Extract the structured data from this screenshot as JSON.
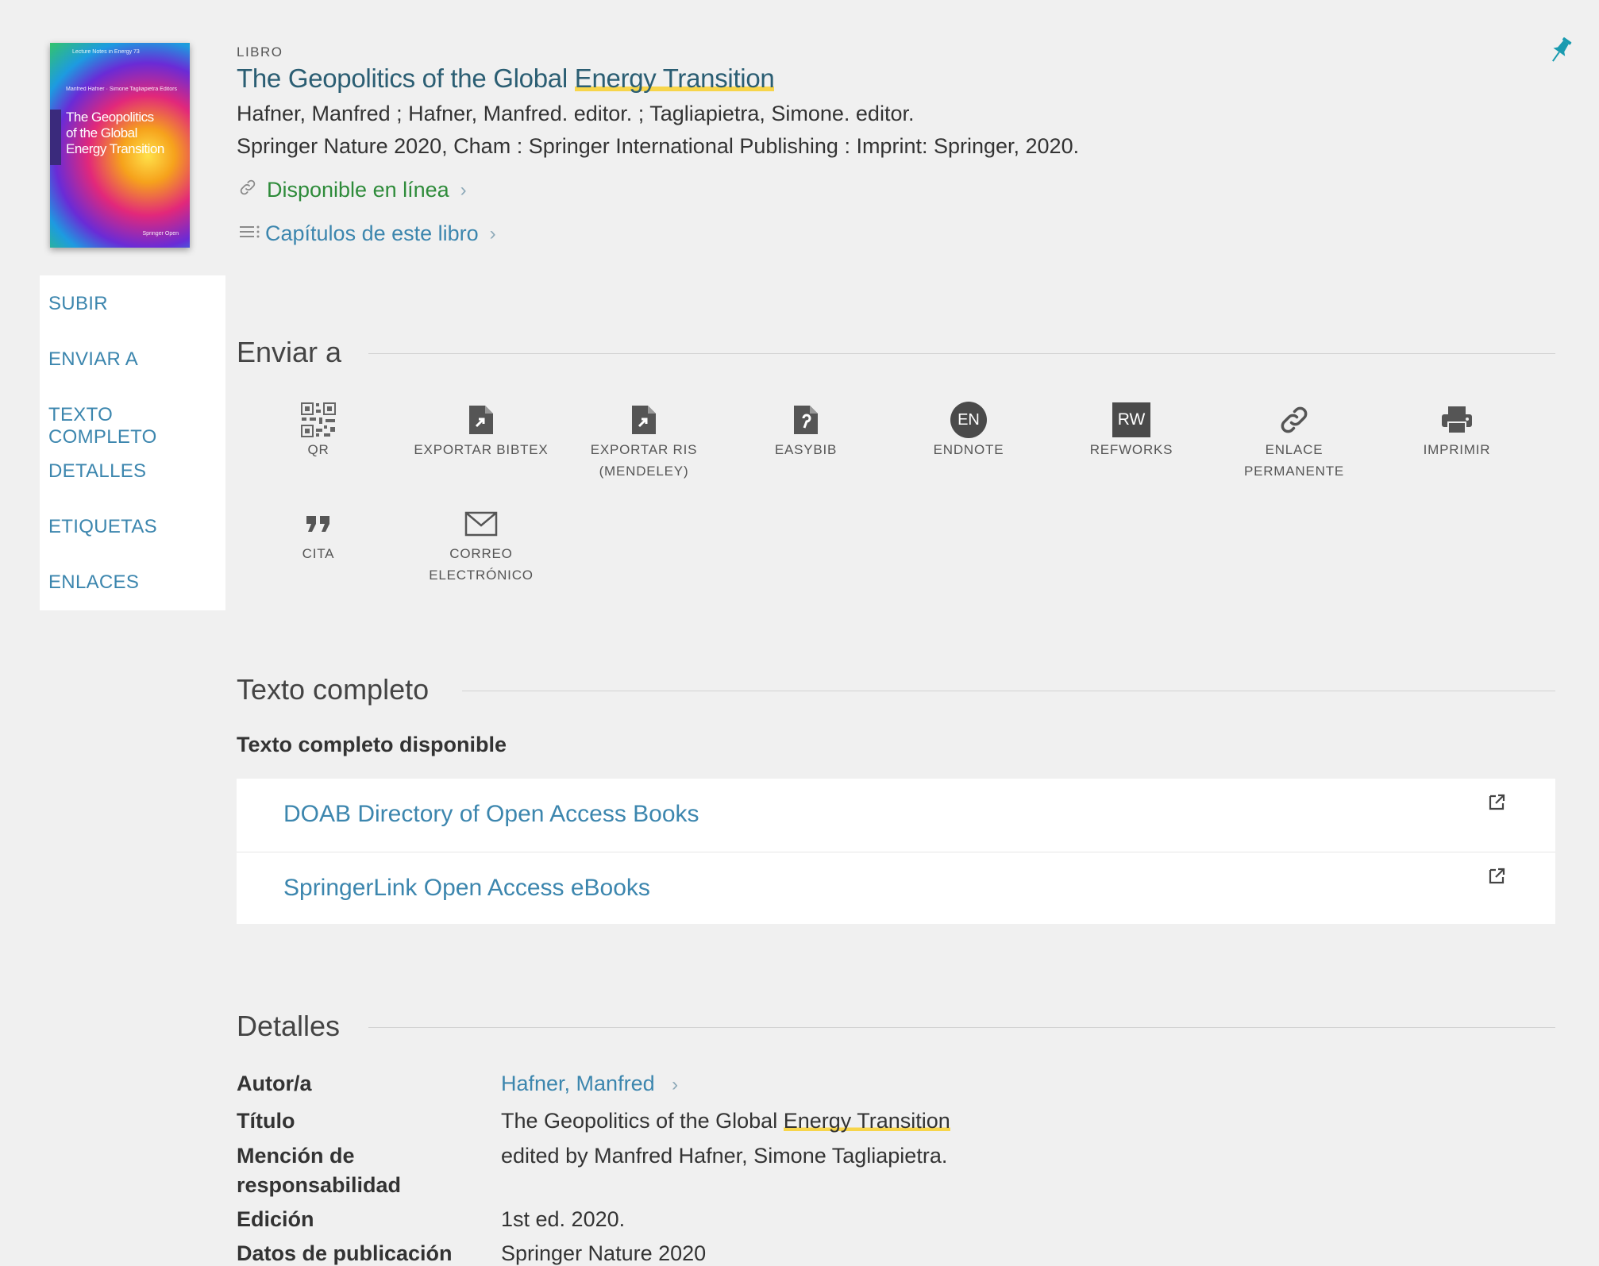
{
  "record": {
    "type_label": "LIBRO",
    "title_part1": "The Geopolitics of the Global ",
    "title_highlight": "Energy Transition",
    "authors": "Hafner, Manfred ; Hafner, Manfred. editor. ; Tagliapietra, Simone. editor.",
    "publisher": "Springer Nature 2020, Cham : Springer International Publishing : Imprint: Springer, 2020.",
    "availability": "Disponible en línea",
    "chapters_link": "Capítulos de este libro",
    "cover": {
      "title_lines": [
        "The Geopolitics",
        "of the Global",
        "Energy Transition"
      ],
      "editors": "Manfred Hafner · Simone Tagliapietra Editors",
      "series": "Lecture Notes in Energy 73",
      "publisher_logo": "Springer Open"
    }
  },
  "leftnav": {
    "items": [
      "SUBIR",
      "ENVIAR A",
      "TEXTO COMPLETO",
      "DETALLES",
      "ETIQUETAS",
      "ENLACES"
    ]
  },
  "send_to": {
    "heading": "Enviar a",
    "items": [
      {
        "label": "QR",
        "icon": "qr-code-icon"
      },
      {
        "label": "EXPORTAR BIBTEX",
        "icon": "file-export-icon"
      },
      {
        "label": "EXPORTAR RIS (MENDELEY)",
        "icon": "file-export-icon"
      },
      {
        "label": "EASYBIB",
        "icon": "easybib-icon"
      },
      {
        "label": "ENDNOTE",
        "icon": "endnote-icon",
        "badge": "EN"
      },
      {
        "label": "REFWORKS",
        "icon": "refworks-icon",
        "badge": "RW"
      },
      {
        "label": "ENLACE PERMANENTE",
        "icon": "link-icon"
      },
      {
        "label": "IMPRIMIR",
        "icon": "print-icon"
      },
      {
        "label": "CITA",
        "icon": "quote-icon"
      },
      {
        "label": "CORREO ELECTRÓNICO",
        "icon": "mail-icon"
      }
    ]
  },
  "fulltext": {
    "heading": "Texto completo",
    "subheading": "Texto completo disponible",
    "links": [
      "DOAB Directory of Open Access Books",
      "SpringerLink Open Access eBooks"
    ]
  },
  "details": {
    "heading": "Detalles",
    "rows": [
      {
        "label": "Autor/a",
        "value": "Hafner, Manfred"
      },
      {
        "label": "Título",
        "value_part1": "The Geopolitics of the Global ",
        "value_highlight": "Energy Transition"
      },
      {
        "label": "Mención de responsabilidad",
        "value": "edited by Manfred Hafner, Simone Tagliapietra."
      },
      {
        "label": "Edición",
        "value": "1st ed. 2020."
      },
      {
        "label": "Datos de publicación",
        "value": "Springer Nature 2020"
      }
    ]
  },
  "colors": {
    "link": "#3c86ae",
    "title": "#2b5e73",
    "available": "#2e8b3a",
    "highlight": "#f7d54a",
    "pin": "#1a9bb0"
  }
}
